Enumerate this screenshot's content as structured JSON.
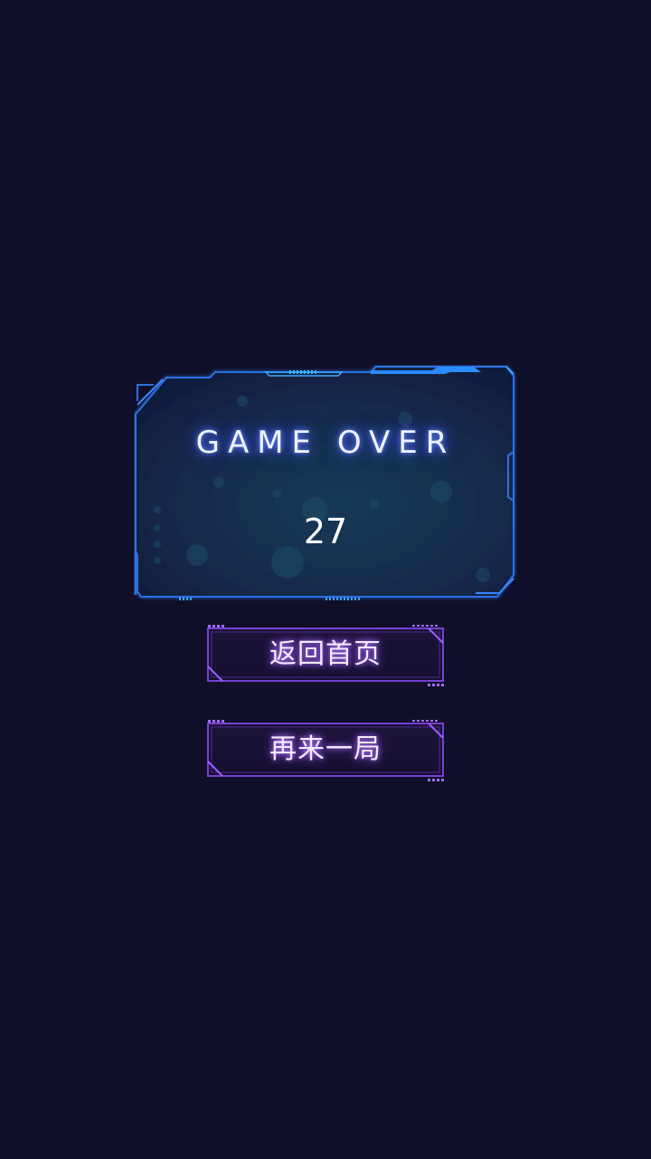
{
  "result": {
    "title": "GAME OVER",
    "score": "27"
  },
  "buttons": {
    "home_label": "返回首页",
    "retry_label": "再来一局"
  },
  "colors": {
    "background": "#0f0f29",
    "panel_frame": "#2f6fe0",
    "panel_fill": "#13264a",
    "button_frame": "#7a3fd0",
    "title_glow": "#3f58e8"
  }
}
